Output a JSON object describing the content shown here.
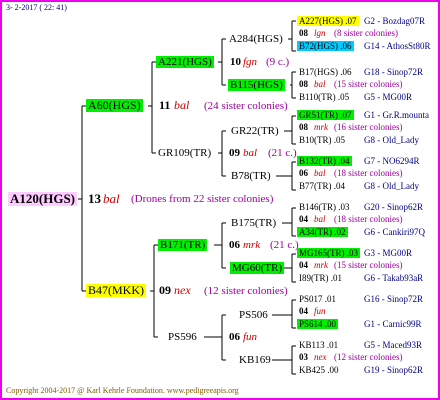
{
  "header": {
    "date": "3- 2-2017 ( 22: 41)"
  },
  "footer": {
    "copyright": "Copyright 2004-2017 @ Karl Kehrle Foundation.   www.pedigreeapis.org"
  },
  "root": {
    "name": "A120(HGS)",
    "num": "13",
    "race": "bal",
    "note": "(Drones from 22 sister colonies)"
  },
  "l1": [
    {
      "name": "A60(HGS)",
      "num": "11",
      "race": "bal",
      "note": "(24 sister colonies)"
    },
    {
      "name": "B47(MKK)",
      "num": "09",
      "race": "nex",
      "note": "(12 sister colonies)"
    }
  ],
  "l2": [
    {
      "name": "A221(HGS)",
      "num": "10",
      "race": "fgn",
      "note": "(9 c.)"
    },
    {
      "name": "GR109(TR)",
      "num": "09",
      "race": "bal",
      "note": "(21 c.)"
    },
    {
      "name": "B171(TR)",
      "num": "06",
      "race": "mrk",
      "note": "(21 c.)"
    },
    {
      "name": "PS596",
      "num": "06",
      "race": "fun",
      "note": ""
    }
  ],
  "l3": [
    {
      "name": "A284(HGS)"
    },
    {
      "name": "B115(HGS)"
    },
    {
      "name": "GR22(TR)"
    },
    {
      "name": "B78(TR)"
    },
    {
      "name": "B175(TR)"
    },
    {
      "name": "MG60(TR)"
    },
    {
      "name": "PS506"
    },
    {
      "name": "KB169"
    }
  ],
  "l4": [
    {
      "top": "A227(HGS) .07",
      "top_right": "G2 - Bozdag07R",
      "mid_num": "08",
      "mid_race": "lgn",
      "mid_note": "(8 sister colonies)",
      "bot": "B72(HGS) .06",
      "bot_right": "G14 - AthosSt80R"
    },
    {
      "top": "B17(HGS) .06",
      "top_right": "G18 - Sinop72R",
      "mid_num": "08",
      "mid_race": "bal",
      "mid_note": "(15 sister colonies)",
      "bot": "B110(TR) .05",
      "bot_right": "G5 - MG00R"
    },
    {
      "top": "GR51(TR) .07",
      "top_right": "G1 - Gr.R.mounta",
      "mid_num": "08",
      "mid_race": "mrk",
      "mid_note": "(16 sister colonies)",
      "bot": "B10(TR) .05",
      "bot_right": "G8 - Old_Lady"
    },
    {
      "top": "B132(TR) .04",
      "top_right": "G7 - NO6294R",
      "mid_num": "06",
      "mid_race": "bal",
      "mid_note": "(18 sister colonies)",
      "bot": "B77(TR) .04",
      "bot_right": "G8 - Old_Lady"
    },
    {
      "top": "B146(TR) .03",
      "top_right": "G20 - Sinop62R",
      "mid_num": "04",
      "mid_race": "bal",
      "mid_note": "(18 sister colonies)",
      "bot": "A34(TR) .02",
      "bot_right": "G6 - Cankiri97Q"
    },
    {
      "top": "MG165(TR) .03",
      "top_right": "G3 - MG00R",
      "mid_num": "04",
      "mid_race": "mrk",
      "mid_note": "(15 sister colonies)",
      "bot": "I89(TR) .01",
      "bot_right": "G6 - Takab93aR"
    },
    {
      "top": "PS017 .01",
      "top_right": "G16 - Sinop72R",
      "mid_num": "04",
      "mid_race": "fun",
      "mid_note": "",
      "bot": "PS614 .00",
      "bot_right": "G1 - Carnic99R"
    },
    {
      "top": "KB113 .01",
      "top_right": "G5 - Maced93R",
      "mid_num": "03",
      "mid_race": "nex",
      "mid_note": "(12 sister colonies)",
      "bot": "KB425 .00",
      "bot_right": "G19 - Sinop62R"
    }
  ]
}
